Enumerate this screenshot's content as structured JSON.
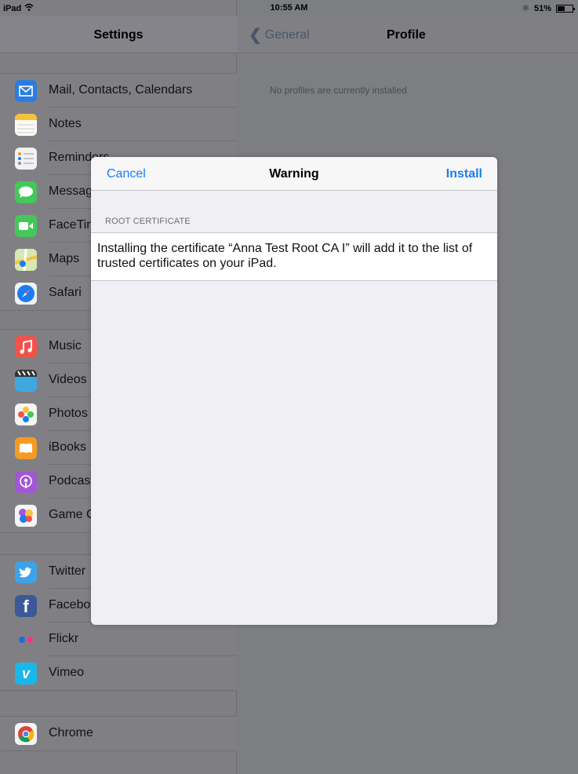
{
  "status_bar": {
    "device": "iPad",
    "time": "10:55 AM",
    "battery": "51%",
    "battery_level": 0.51
  },
  "settings": {
    "title": "Settings",
    "groups": [
      {
        "items": [
          {
            "label": "Mail, Contacts, Calendars",
            "icon": "mail-icon",
            "color": "#2a7de0"
          },
          {
            "label": "Notes",
            "icon": "notes-icon",
            "color": "#f5c33b"
          },
          {
            "label": "Reminders",
            "icon": "reminders-icon",
            "color": "#f2f2f2"
          },
          {
            "label": "Messages",
            "icon": "messages-icon",
            "color": "#43c859"
          },
          {
            "label": "FaceTime",
            "icon": "facetime-icon",
            "color": "#43c859"
          },
          {
            "label": "Maps",
            "icon": "maps-icon",
            "color": "#8fbf6a"
          },
          {
            "label": "Safari",
            "icon": "safari-icon",
            "color": "#1a7cf2"
          }
        ]
      },
      {
        "items": [
          {
            "label": "Music",
            "icon": "music-icon",
            "color": "#f2524a"
          },
          {
            "label": "Videos",
            "icon": "videos-icon",
            "color": "#40a8e0"
          },
          {
            "label": "Photos",
            "icon": "photos-icon",
            "color": "#f5f5f5"
          },
          {
            "label": "iBooks",
            "icon": "ibooks-icon",
            "color": "#f59a23"
          },
          {
            "label": "Podcasts",
            "icon": "podcasts-icon",
            "color": "#a157d6"
          },
          {
            "label": "Game Center",
            "icon": "game-center-icon",
            "color": "#f5f5f5"
          }
        ]
      },
      {
        "items": [
          {
            "label": "Twitter",
            "icon": "twitter-icon",
            "color": "#3ca3e8"
          },
          {
            "label": "Facebook",
            "icon": "facebook-icon",
            "color": "#3b5998"
          },
          {
            "label": "Flickr",
            "icon": "flickr-icon",
            "color": "#f7f7f7"
          },
          {
            "label": "Vimeo",
            "icon": "vimeo-icon",
            "color": "#1ab7ea"
          }
        ]
      },
      {
        "items": [
          {
            "label": "Chrome",
            "icon": "chrome-icon",
            "color": "#f5f5f5"
          }
        ]
      }
    ]
  },
  "profile": {
    "back_label": "General",
    "title": "Profile",
    "empty_message": "No profiles are currently installed"
  },
  "modal": {
    "cancel_label": "Cancel",
    "title": "Warning",
    "install_label": "Install",
    "section_label": "ROOT CERTIFICATE",
    "message": "Installing the certificate “Anna Test Root CA I” will add it to the list of trusted certificates on your iPad."
  },
  "colors": {
    "accent": "#1a7cf2",
    "dimmed_background": "#7d7e82"
  }
}
